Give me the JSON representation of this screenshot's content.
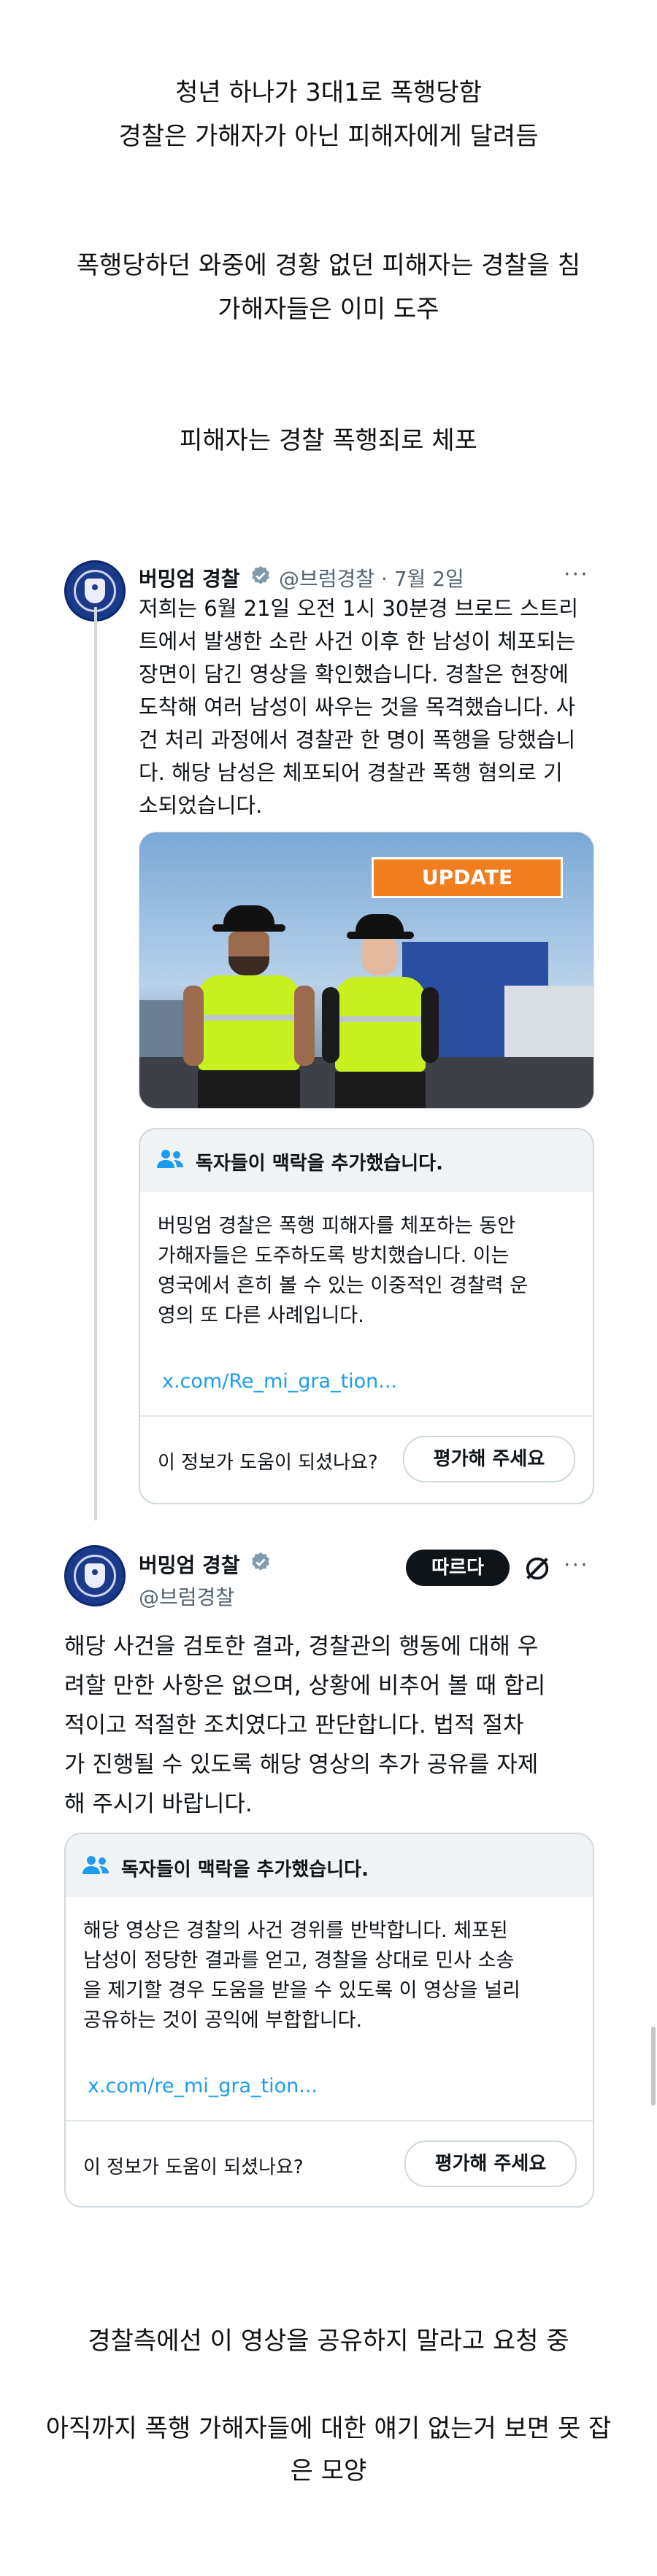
{
  "intro": {
    "line1": "청년 하나가 3대1로 폭행당함",
    "line2": "경찰은 가해자가 아닌 피해자에게 달려듬",
    "line3": "폭행당하던 와중에 경황 없던 피해자는 경찰을 침",
    "line4": "가해자들은 이미 도주",
    "line5": "피해자는 경찰 폭행죄로 체포"
  },
  "tweet1": {
    "display_name": "버밍엄 경찰",
    "handle_date": "@브럼경찰 · 7월 2일",
    "more": "···",
    "body": [
      "저희는 6월 21일 오전 1시 30분경 브로드 스트리",
      "트에서 발생한 소란 사건 이후 한 남성이 체포되는",
      "장면이 담긴 영상을 확인했습니다. 경찰은 현장에",
      "도착해 여러 남성이 싸우는 것을 목격했습니다. 사",
      "건 처리 과정에서 경찰관 한 명이 폭행을 당했습니",
      "다. 해당 남성은 체포되어 경찰관 폭행 혐의로 기",
      "소되었습니다."
    ],
    "media_badge": "UPDATE",
    "note": {
      "header": "독자들이 맥락을 추가했습니다.",
      "lines": [
        "버밍엄 경찰은 폭행 피해자를 체포하는 동안",
        "가해자들은 도주하도록 방치했습니다. 이는",
        "영국에서 흔히 볼 수 있는 이중적인 경찰력 운",
        "영의 또 다른 사례입니다."
      ],
      "link": "x.com/Re_mi_gra_tion...",
      "helpful_q": "이 정보가 도움이 되셨나요?",
      "rate_label": "평가해 주세요"
    }
  },
  "tweet2": {
    "display_name": "버밍엄 경찰",
    "handle": "@브럼경찰",
    "follow_label": "따르다",
    "more": "···",
    "body": [
      "해당 사건을 검토한 결과, 경찰관의 행동에 대해 우",
      "려할 만한 사항은 없으며, 상황에 비추어 볼 때 합리",
      "적이고 적절한 조치였다고 판단합니다. 법적 절차",
      "가 진행될 수 있도록 해당 영상의 추가 공유를 자제",
      "해 주시기 바랍니다."
    ],
    "note": {
      "header": "독자들이 맥락을 추가했습니다.",
      "lines": [
        "해당 영상은 경찰의 사건 경위를 반박합니다. 체포된",
        "남성이 정당한 결과를 얻고, 경찰을 상대로 민사 소송",
        "을 제기할 경우 도움을 받을 수 있도록 이 영상을 널리",
        "공유하는 것이 공익에 부합합니다."
      ],
      "link": "x.com/re_mi_gra_tion...",
      "helpful_q": "이 정보가 도움이 되셨나요?",
      "rate_label": "평가해 주세요"
    }
  },
  "outro": {
    "line1": "경찰측에선 이 영상을 공유하지 말라고 요청 중",
    "line2": "아직까지 폭행 가해자들에 대한 얘기 없는거 보면 못 잡",
    "line3": "은 모양"
  },
  "colors": {
    "link": "#1d9bf0",
    "verified": "#1d9bf0",
    "update_badge": "#f07e1f",
    "hi_vis": "#c8f01e"
  }
}
